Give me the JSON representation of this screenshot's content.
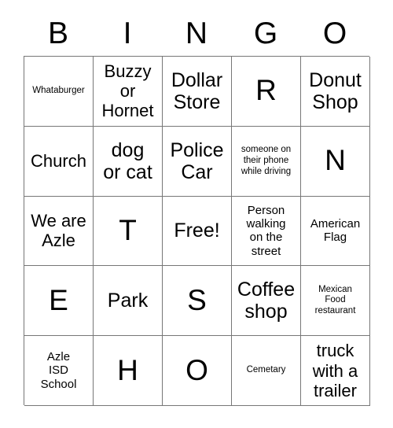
{
  "card": {
    "title": "BINGO",
    "header_letters": [
      "B",
      "I",
      "N",
      "G",
      "O"
    ],
    "rows": [
      [
        {
          "text": "Whataburger",
          "size": "xs"
        },
        {
          "text": "Buzzy\nor\nHornet",
          "size": "md"
        },
        {
          "text": "Dollar\nStore",
          "size": "lg"
        },
        {
          "text": "R",
          "size": "xl"
        },
        {
          "text": "Donut\nShop",
          "size": "lg"
        }
      ],
      [
        {
          "text": "Church",
          "size": "md"
        },
        {
          "text": "dog\nor cat",
          "size": "lg"
        },
        {
          "text": "Police\nCar",
          "size": "lg"
        },
        {
          "text": "someone on\ntheir phone\nwhile driving",
          "size": "xs"
        },
        {
          "text": "N",
          "size": "xl"
        }
      ],
      [
        {
          "text": "We are\nAzle",
          "size": "md"
        },
        {
          "text": "T",
          "size": "xl"
        },
        {
          "text": "Free!",
          "size": "lg"
        },
        {
          "text": "Person\nwalking\non the\nstreet",
          "size": "sm"
        },
        {
          "text": "American\nFlag",
          "size": "sm"
        }
      ],
      [
        {
          "text": "E",
          "size": "xl"
        },
        {
          "text": "Park",
          "size": "lg"
        },
        {
          "text": "S",
          "size": "xl"
        },
        {
          "text": "Coffee\nshop",
          "size": "lg"
        },
        {
          "text": "Mexican\nFood\nrestaurant",
          "size": "xs"
        }
      ],
      [
        {
          "text": "Azle\nISD\nSchool",
          "size": "sm"
        },
        {
          "text": "H",
          "size": "xl"
        },
        {
          "text": "O",
          "size": "xl"
        },
        {
          "text": "Cemetary",
          "size": "xs"
        },
        {
          "text": "truck\nwith a\ntrailer",
          "size": "md"
        }
      ]
    ],
    "free_space": "Free!",
    "colors": {
      "background": "#ffffff",
      "text": "#000000",
      "grid_line": "#777777"
    }
  }
}
